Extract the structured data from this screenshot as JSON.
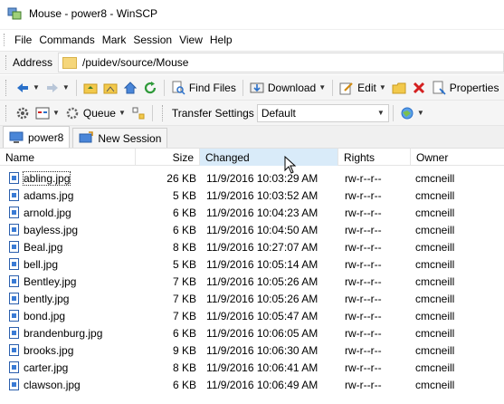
{
  "window": {
    "title": "Mouse - power8 - WinSCP",
    "icon": "winscp-app-icon"
  },
  "menu": {
    "items": [
      "File",
      "Commands",
      "Mark",
      "Session",
      "View",
      "Help"
    ]
  },
  "address": {
    "label": "Address",
    "path": "/puidev/source/Mouse"
  },
  "toolbar1": {
    "find_files": "Find Files",
    "download": "Download",
    "edit": "Edit",
    "properties": "Properties"
  },
  "toolbar2": {
    "queue": "Queue",
    "transfer_settings_label": "Transfer Settings",
    "transfer_settings_value": "Default"
  },
  "tabs": [
    {
      "label": "power8",
      "icon": "session-computer-icon",
      "active": true
    },
    {
      "label": "New Session",
      "icon": "new-session-icon",
      "active": false
    }
  ],
  "columns": {
    "name": "Name",
    "size": "Size",
    "changed": "Changed",
    "rights": "Rights",
    "owner": "Owner"
  },
  "files": [
    {
      "name": "abling.jpg",
      "size": "26 KB",
      "changed": "11/9/2016 10:03:29 AM",
      "rights": "rw-r--r--",
      "owner": "cmcneill"
    },
    {
      "name": "adams.jpg",
      "size": "5 KB",
      "changed": "11/9/2016 10:03:52 AM",
      "rights": "rw-r--r--",
      "owner": "cmcneill"
    },
    {
      "name": "arnold.jpg",
      "size": "6 KB",
      "changed": "11/9/2016 10:04:23 AM",
      "rights": "rw-r--r--",
      "owner": "cmcneill"
    },
    {
      "name": "bayless.jpg",
      "size": "6 KB",
      "changed": "11/9/2016 10:04:50 AM",
      "rights": "rw-r--r--",
      "owner": "cmcneill"
    },
    {
      "name": "Beal.jpg",
      "size": "8 KB",
      "changed": "11/9/2016 10:27:07 AM",
      "rights": "rw-r--r--",
      "owner": "cmcneill"
    },
    {
      "name": "bell.jpg",
      "size": "5 KB",
      "changed": "11/9/2016 10:05:14 AM",
      "rights": "rw-r--r--",
      "owner": "cmcneill"
    },
    {
      "name": "Bentley.jpg",
      "size": "7 KB",
      "changed": "11/9/2016 10:05:26 AM",
      "rights": "rw-r--r--",
      "owner": "cmcneill"
    },
    {
      "name": "bently.jpg",
      "size": "7 KB",
      "changed": "11/9/2016 10:05:26 AM",
      "rights": "rw-r--r--",
      "owner": "cmcneill"
    },
    {
      "name": "bond.jpg",
      "size": "7 KB",
      "changed": "11/9/2016 10:05:47 AM",
      "rights": "rw-r--r--",
      "owner": "cmcneill"
    },
    {
      "name": "brandenburg.jpg",
      "size": "6 KB",
      "changed": "11/9/2016 10:06:05 AM",
      "rights": "rw-r--r--",
      "owner": "cmcneill"
    },
    {
      "name": "brooks.jpg",
      "size": "9 KB",
      "changed": "11/9/2016 10:06:30 AM",
      "rights": "rw-r--r--",
      "owner": "cmcneill"
    },
    {
      "name": "carter.jpg",
      "size": "8 KB",
      "changed": "11/9/2016 10:06:41 AM",
      "rights": "rw-r--r--",
      "owner": "cmcneill"
    },
    {
      "name": "clawson.jpg",
      "size": "6 KB",
      "changed": "11/9/2016 10:06:49 AM",
      "rights": "rw-r--r--",
      "owner": "cmcneill"
    }
  ],
  "colors": {
    "accent": "#1e73c8",
    "header_hover": "#d9ebf9"
  }
}
